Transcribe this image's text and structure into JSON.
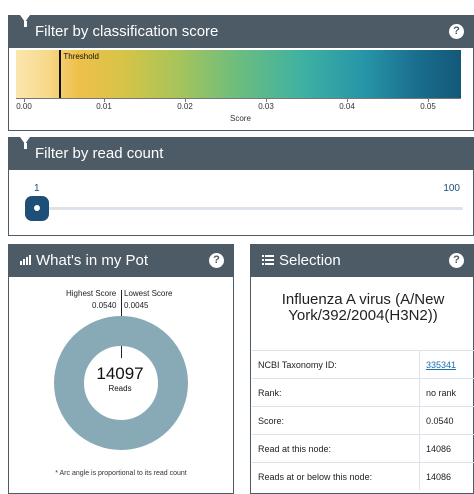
{
  "score_panel": {
    "title": "Filter by classification score",
    "help": "?",
    "threshold_label": "Threshold",
    "threshold_value": 0.0045,
    "axis_label": "Score",
    "ticks": [
      "0.00",
      "0.01",
      "0.02",
      "0.03",
      "0.04",
      "0.05"
    ],
    "icon": "funnel-icon"
  },
  "read_panel": {
    "title": "Filter by read count",
    "min": "1",
    "max": "100",
    "icon": "funnel-icon"
  },
  "pot_panel": {
    "title": "What's in my Pot",
    "help": "?",
    "highest_label": "Highest Score",
    "lowest_label": "Lowest Score",
    "highest_value": "0.0540",
    "lowest_value": "0.0045",
    "reads_count": "14097",
    "reads_label": "Reads",
    "note": "* Arc angle is proportional to its read count",
    "donut_color": "#88aab6",
    "icon": "bar-chart-icon"
  },
  "selection_panel": {
    "title": "Selection",
    "help": "?",
    "organism": "Influenza A virus (A/New York/392/2004(H3N2))",
    "rows": [
      {
        "key": "NCBI Taxonomy ID:",
        "value": "335341"
      },
      {
        "key": "Rank:",
        "value": "no rank"
      },
      {
        "key": "Score:",
        "value": "0.0540"
      },
      {
        "key": "Read at this node:",
        "value": "14086"
      },
      {
        "key": "Reads at or below this node:",
        "value": "14086"
      }
    ],
    "icon": "list-icon"
  }
}
